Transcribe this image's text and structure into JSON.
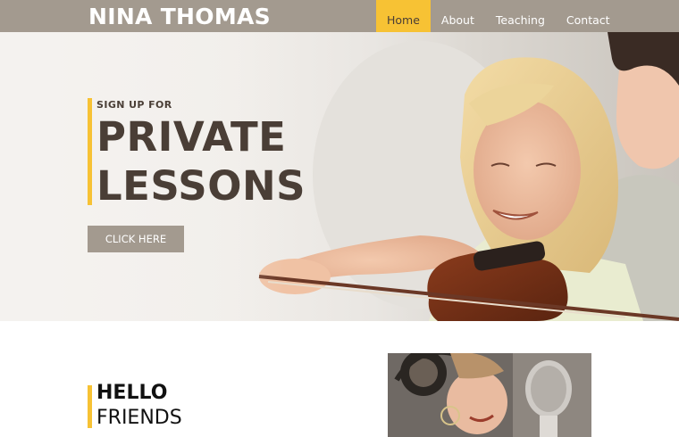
{
  "site": {
    "logo": "NINA THOMAS"
  },
  "nav": {
    "items": [
      {
        "label": "Home",
        "active": true
      },
      {
        "label": "About",
        "active": false
      },
      {
        "label": "Teaching",
        "active": false
      },
      {
        "label": "Contact",
        "active": false
      }
    ]
  },
  "hero": {
    "kicker": "SIGN UP FOR",
    "headline_line1": "PRIVATE",
    "headline_line2": "LESSONS",
    "cta_label": "CLICK HERE"
  },
  "intro": {
    "title": "HELLO",
    "subtitle": "FRIENDS"
  },
  "colors": {
    "header_bg": "#a39a8f",
    "accent": "#f7c234",
    "text_dark": "#4a3e36"
  }
}
